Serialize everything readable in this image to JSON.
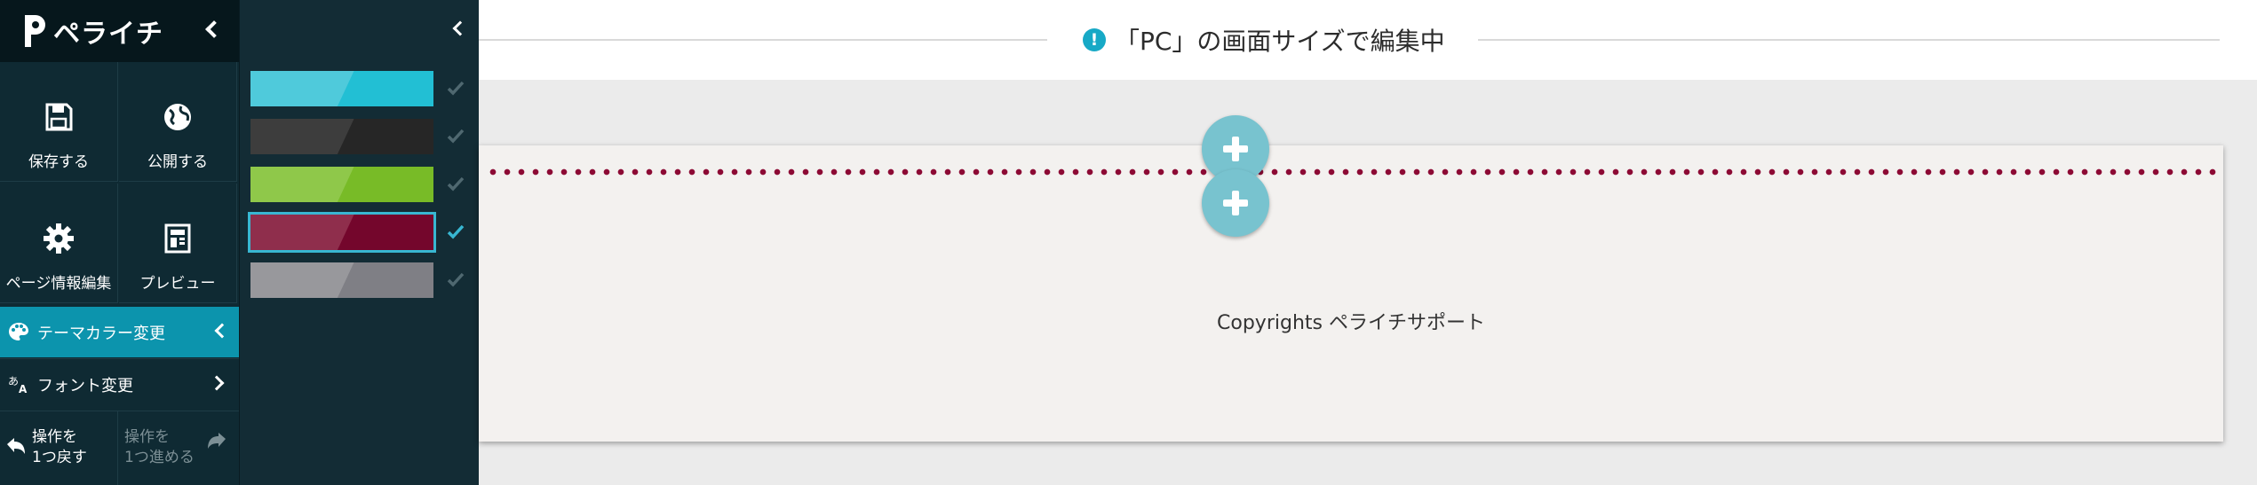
{
  "brand": {
    "name": "ペライチ"
  },
  "tools": {
    "save": "保存する",
    "publish": "公開する",
    "page_info": "ページ情報編集",
    "preview": "プレビュー"
  },
  "menu": {
    "theme_color": "テーマカラー変更",
    "font": "フォント変更"
  },
  "history": {
    "undo_line1": "操作を",
    "undo_line2": "1つ戻す",
    "redo_line1": "操作を",
    "redo_line2": "1つ進める"
  },
  "notice": {
    "text": "「PC」の画面サイズで編集中"
  },
  "palettes": [
    {
      "name": "cyan",
      "light": "#4fcadb",
      "dark": "#22bfd4",
      "selected": false
    },
    {
      "name": "dark-gray",
      "light": "#3d3d3d",
      "dark": "#262626",
      "selected": false
    },
    {
      "name": "green",
      "light": "#8fc84a",
      "dark": "#78bb27",
      "selected": false
    },
    {
      "name": "crimson",
      "light": "#8f2e4c",
      "dark": "#74062c",
      "selected": true
    },
    {
      "name": "gray",
      "light": "#98989c",
      "dark": "#7f7f85",
      "selected": false
    }
  ],
  "footer_block": {
    "copyright": "Copyrights ペライチサポート"
  },
  "colors": {
    "accent": "#0c94ad",
    "sidebar_bg": "#0f2a33",
    "dotted_line": "#8c0a34",
    "add_button": "#78c3cf"
  }
}
